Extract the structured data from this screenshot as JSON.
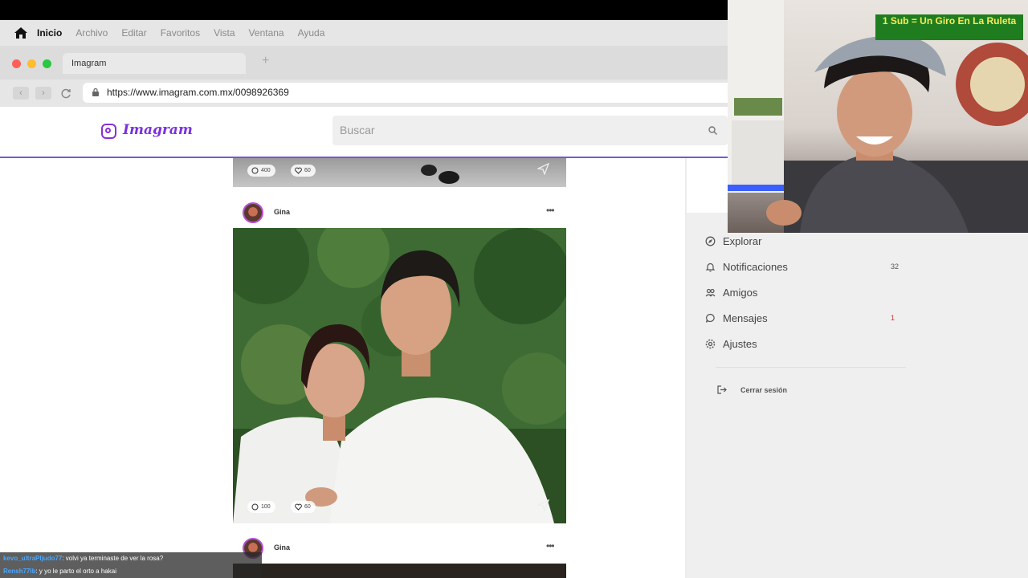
{
  "menu": {
    "items": [
      "Inicio",
      "Archivo",
      "Editar",
      "Favoritos",
      "Vista",
      "Ventana",
      "Ayuda"
    ]
  },
  "browser": {
    "tab_title": "Imagram",
    "new_tab": "+",
    "url": "https://www.imagram.com.mx/0098926369"
  },
  "app": {
    "logo": "Imagram",
    "search_placeholder": "Buscar"
  },
  "posts": [
    {
      "comments": "400",
      "likes": "60"
    },
    {
      "user": "Gina",
      "comments": "100",
      "likes": "60",
      "more": "•••"
    },
    {
      "user": "Gina",
      "more": "•••"
    }
  ],
  "sidebar": {
    "items": [
      {
        "label": "Explorar",
        "icon": "compass-icon"
      },
      {
        "label": "Notificaciones",
        "icon": "bell-icon",
        "count": "32"
      },
      {
        "label": "Amigos",
        "icon": "people-icon"
      },
      {
        "label": "Mensajes",
        "icon": "chat-bubble-icon",
        "count": "1",
        "count_color": "#d0342c"
      },
      {
        "label": "Ajustes",
        "icon": "gear-icon"
      }
    ],
    "logout": "Cerrar sesión"
  },
  "overlay": {
    "banner": "1 Sub = Un Giro En La Ruleta",
    "chat": [
      {
        "user": "kevo_ultraPIjudo77",
        "text": ": volvi ya terminaste de ver la rosa?"
      },
      {
        "user": "Rensh77lb",
        "text": ": y yo le parto el orto a hakai"
      }
    ]
  },
  "colors": {
    "brand": "#7b2fe0",
    "accent_line": "#7a56d6"
  }
}
